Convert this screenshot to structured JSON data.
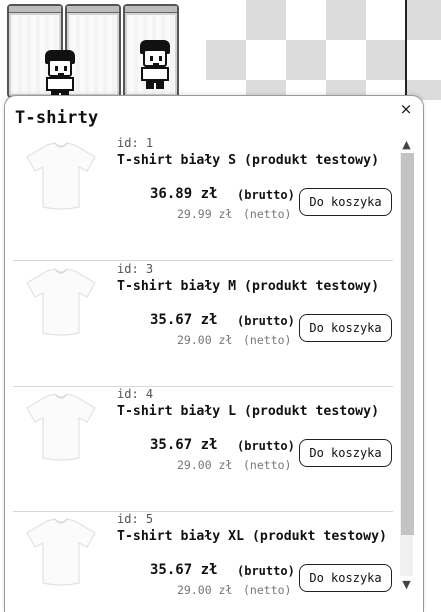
{
  "modal": {
    "title": "T-shirty",
    "close_label": "×"
  },
  "products": [
    {
      "id_label": "id: 1",
      "name": "T-shirt biały S (produkt testowy)",
      "price_gross": "36.89 zł",
      "gross_label": "(brutto)",
      "price_net": "29.99 zł",
      "net_label": "(netto)",
      "button_label": "Do koszyka"
    },
    {
      "id_label": "id: 3",
      "name": "T-shirt biały M (produkt testowy)",
      "price_gross": "35.67 zł",
      "gross_label": "(brutto)",
      "price_net": "29.00 zł",
      "net_label": "(netto)",
      "button_label": "Do koszyka"
    },
    {
      "id_label": "id: 4",
      "name": "T-shirt biały L (produkt testowy)",
      "price_gross": "35.67 zł",
      "gross_label": "(brutto)",
      "price_net": "29.00 zł",
      "net_label": "(netto)",
      "button_label": "Do koszyka"
    },
    {
      "id_label": "id: 5",
      "name": "T-shirt biały XL (produkt testowy)",
      "price_gross": "35.67 zł",
      "gross_label": "(brutto)",
      "price_net": "29.00 zł",
      "net_label": "(netto)",
      "button_label": "Do koszyka"
    }
  ],
  "scrollbar": {
    "up_icon": "▲",
    "down_icon": "▼"
  },
  "icons": {
    "product_image": "white-tshirt-icon",
    "close": "close-icon",
    "characters": "pixel-character-icon",
    "shelves": "clothing-shelf-icon"
  }
}
